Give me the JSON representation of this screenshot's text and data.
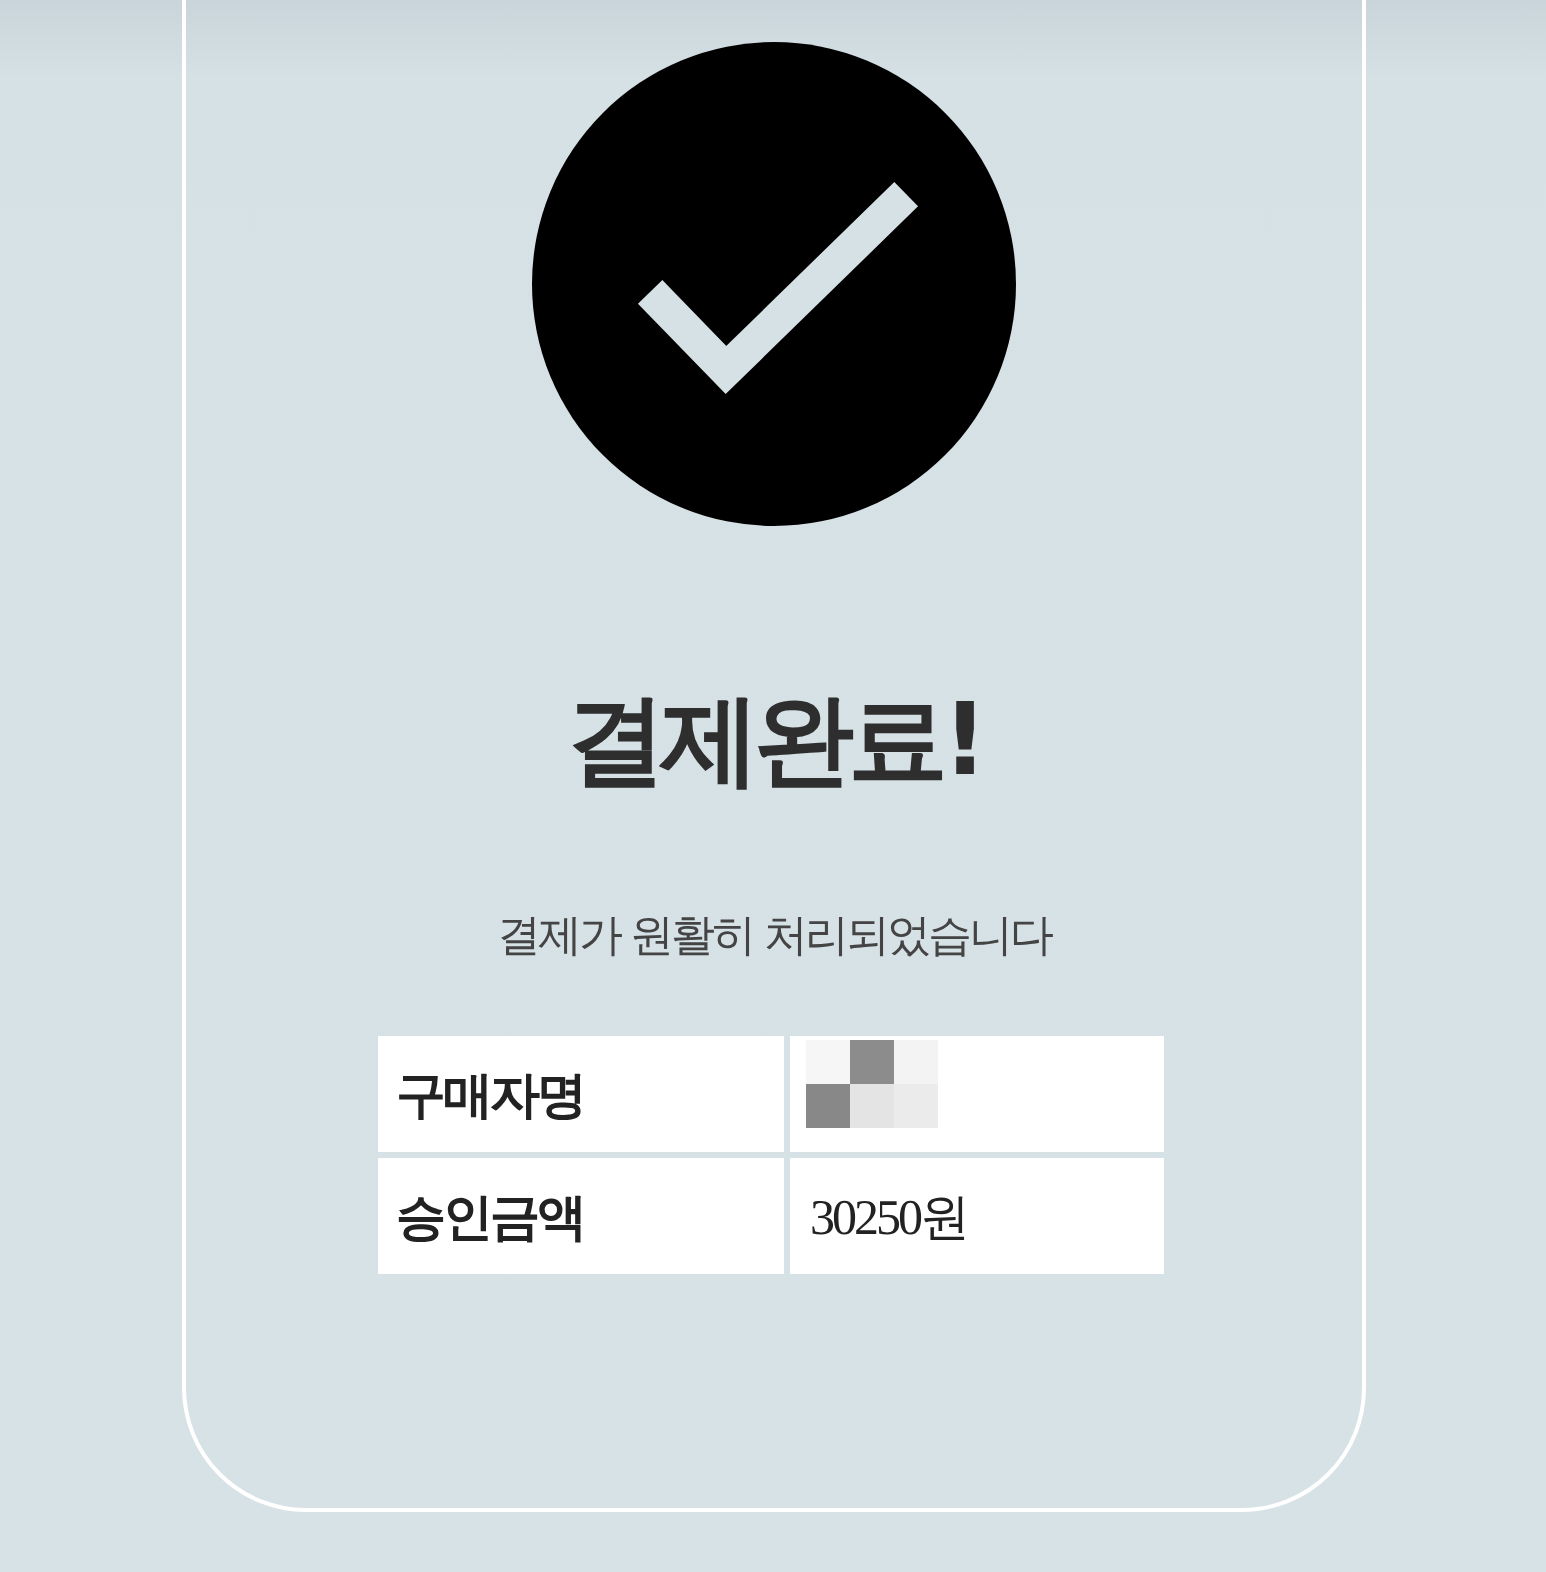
{
  "title": "결제완료!",
  "message": "결제가 원활히 처리되었습니다",
  "details": [
    {
      "label": "구매자명",
      "kind": "redacted"
    },
    {
      "label": "승인금액",
      "kind": "text",
      "value": "30250원"
    }
  ]
}
